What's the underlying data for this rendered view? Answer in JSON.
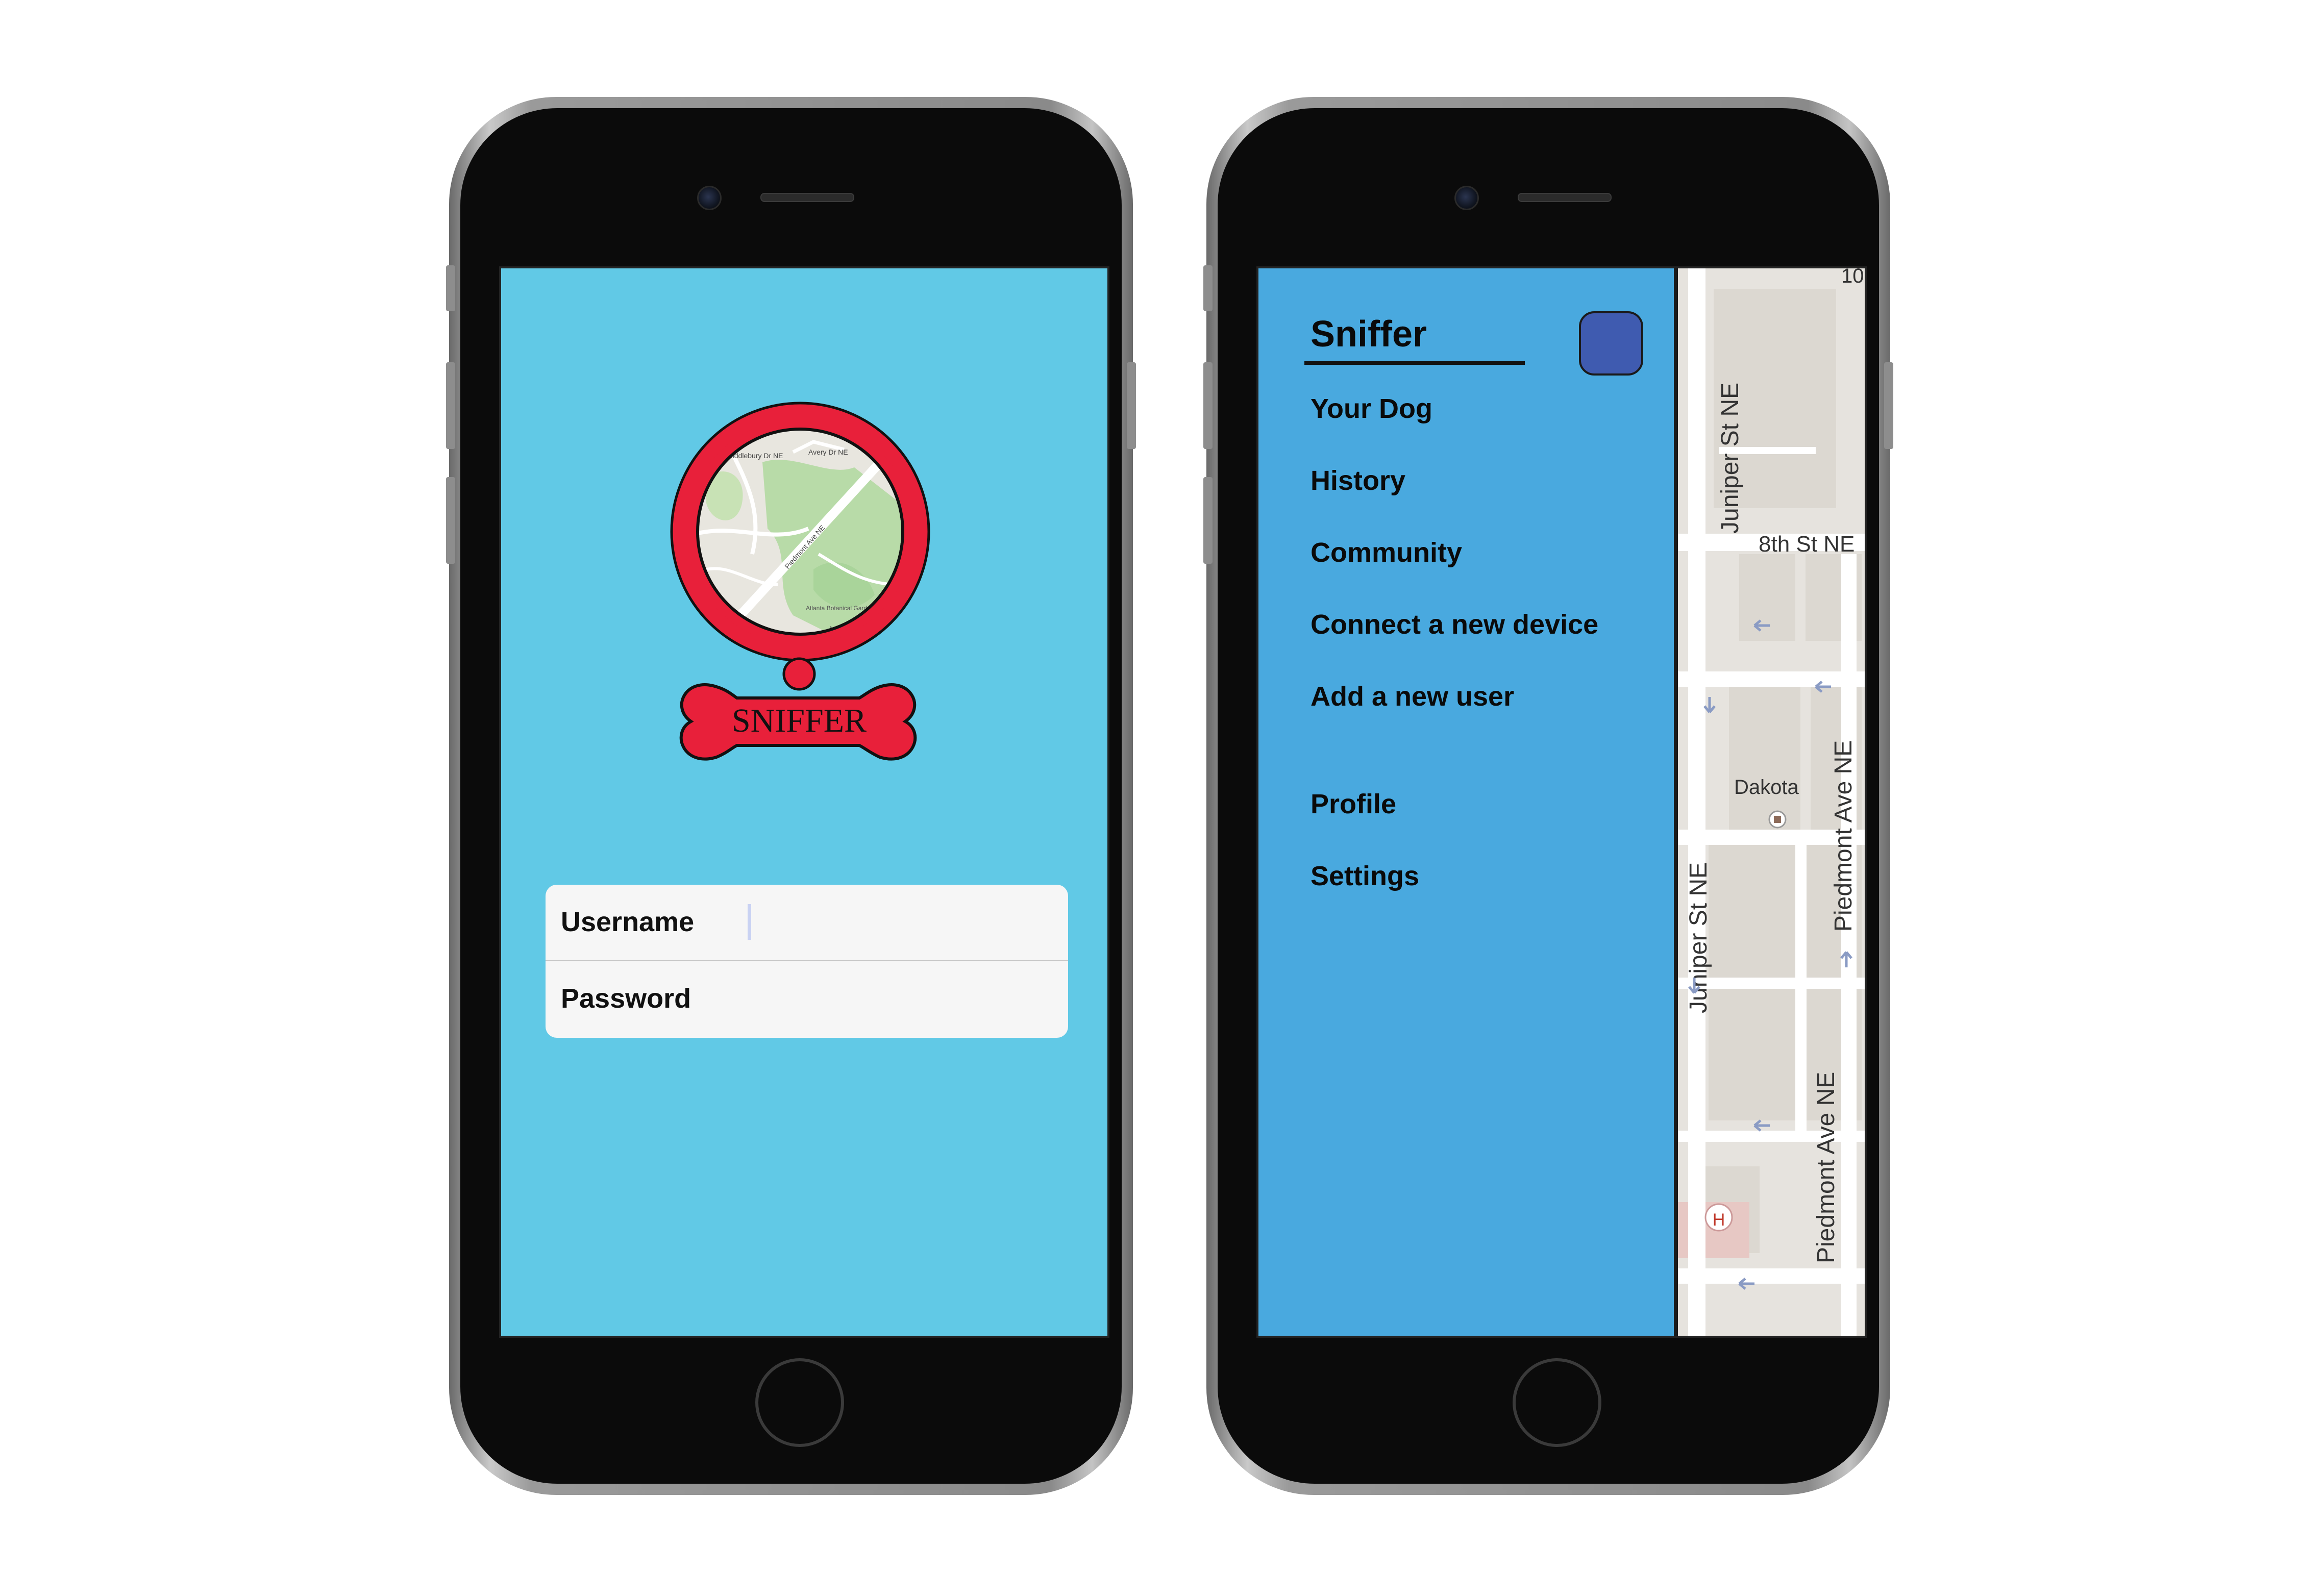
{
  "login_screen": {
    "logo_text": "SNIFFER",
    "logo_map_labels": [
      "Middlebury Dr NE",
      "Avery Dr NE",
      "Piedmont Ave NE",
      "Atlanta Botanical Garden",
      "Amsterdam Ave"
    ],
    "username_label": "Username",
    "password_label": "Password",
    "username_value": "",
    "password_value": "",
    "colors": {
      "background": "#61c9e6",
      "logo_red": "#e8203a"
    }
  },
  "menu_screen": {
    "app_title": "Sniffer",
    "menu_items": [
      {
        "label": "Your Dog"
      },
      {
        "label": "History"
      },
      {
        "label": "Community"
      },
      {
        "label": "Connect a new device"
      },
      {
        "label": "Add a new user"
      },
      {
        "label": "Profile"
      },
      {
        "label": "Settings"
      }
    ],
    "map_labels": {
      "juniper_top": "Juniper St NE",
      "eighth_st": "8th St NE",
      "dakota": "Dakota",
      "juniper_bottom": "Juniper St NE",
      "piedmont_top": "Piedmont Ave NE",
      "piedmont_bottom": "Piedmont Ave NE",
      "hospital_marker": "H",
      "corner_text": "10"
    },
    "colors": {
      "drawer": "#49a9df",
      "avatar": "#3f5bb0",
      "map_background": "#e6e3de"
    }
  }
}
